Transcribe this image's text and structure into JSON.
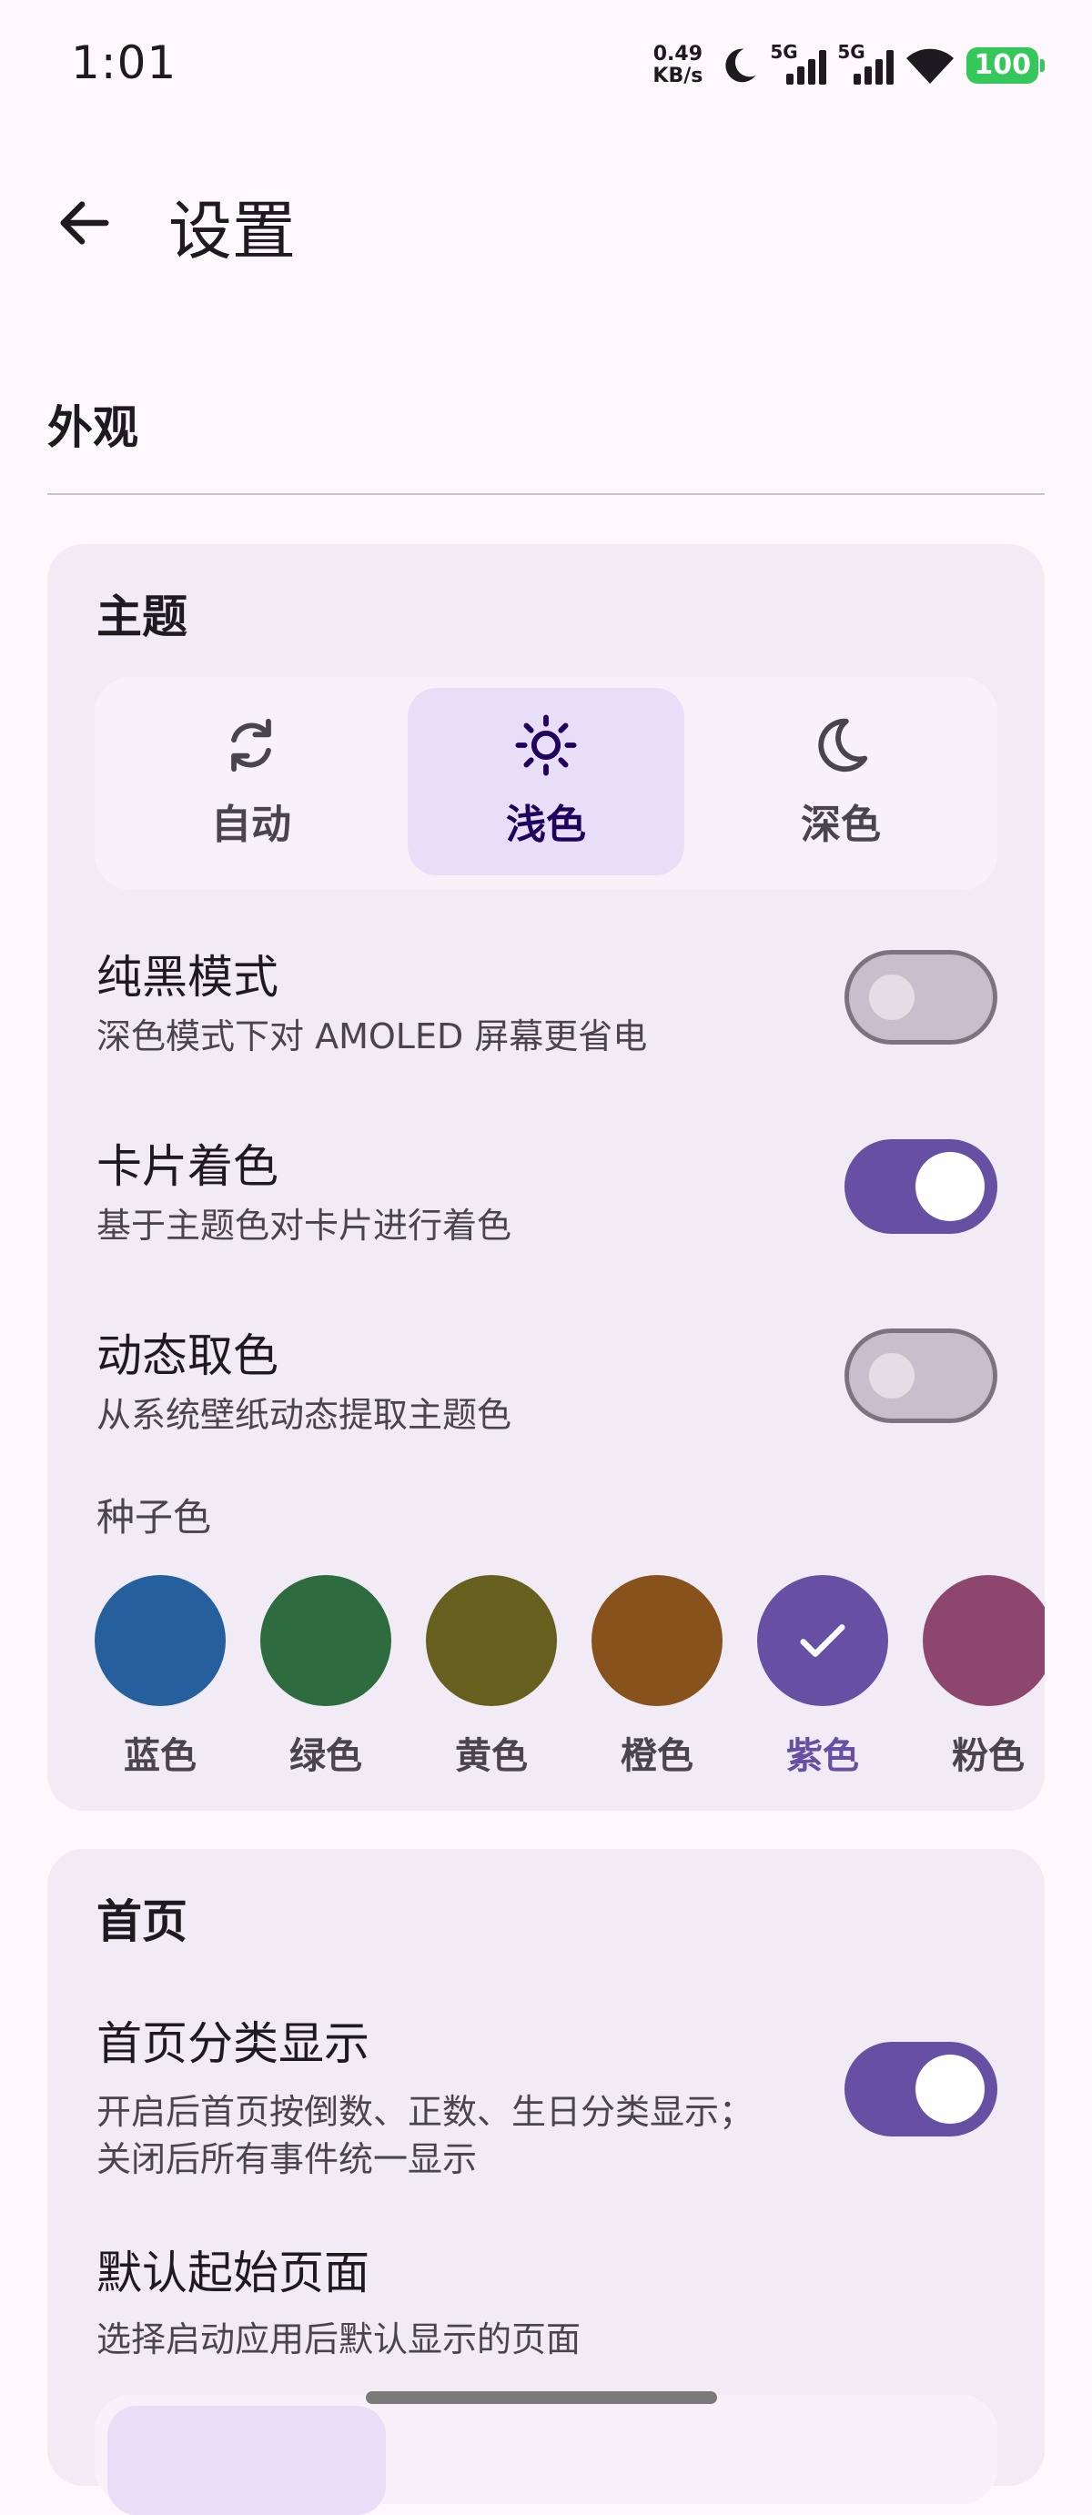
{
  "status_bar": {
    "time": "1:01",
    "net_speed_value": "0.49",
    "net_speed_unit": "KB/s",
    "sim1_label": "5G",
    "sim2_label": "5G",
    "battery": "100"
  },
  "header": {
    "title": "设置"
  },
  "appearance": {
    "section_title": "外观",
    "theme_card": {
      "title": "主题",
      "options": [
        {
          "label": "自动",
          "icon": "sync-icon"
        },
        {
          "label": "浅色",
          "icon": "sun-icon"
        },
        {
          "label": "深色",
          "icon": "moon-icon"
        }
      ],
      "selected": "浅色"
    },
    "pure_black": {
      "title": "纯黑模式",
      "subtitle": "深色模式下对 AMOLED 屏幕更省电",
      "enabled": false
    },
    "card_tint": {
      "title": "卡片着色",
      "subtitle": "基于主题色对卡片进行着色",
      "enabled": true
    },
    "dynamic_color": {
      "title": "动态取色",
      "subtitle": "从系统壁纸动态提取主题色",
      "enabled": false
    },
    "seed_color": {
      "label": "种子色",
      "colors": [
        {
          "label": "蓝色",
          "hex": "#255F9E"
        },
        {
          "label": "绿色",
          "hex": "#2E6B3F"
        },
        {
          "label": "黄色",
          "hex": "#675F1E"
        },
        {
          "label": "橙色",
          "hex": "#87521B"
        },
        {
          "label": "紫色",
          "hex": "#6750A4"
        },
        {
          "label": "粉色",
          "hex": "#8D476E"
        }
      ],
      "selected": "紫色"
    }
  },
  "home_card": {
    "title": "首页",
    "category_display": {
      "title": "首页分类显示",
      "subtitle_line1": "开启后首页按倒数、正数、生日分类显示；",
      "subtitle_line2": "关闭后所有事件统一显示",
      "enabled": true
    },
    "default_page": {
      "title": "默认起始页面",
      "subtitle": "选择启动应用后默认显示的页面"
    }
  },
  "colors": {
    "accent": "#6750A4",
    "card_bg": "#F0EBF5",
    "selected_segment": "#E8DEF8",
    "battery": "#34C759"
  }
}
